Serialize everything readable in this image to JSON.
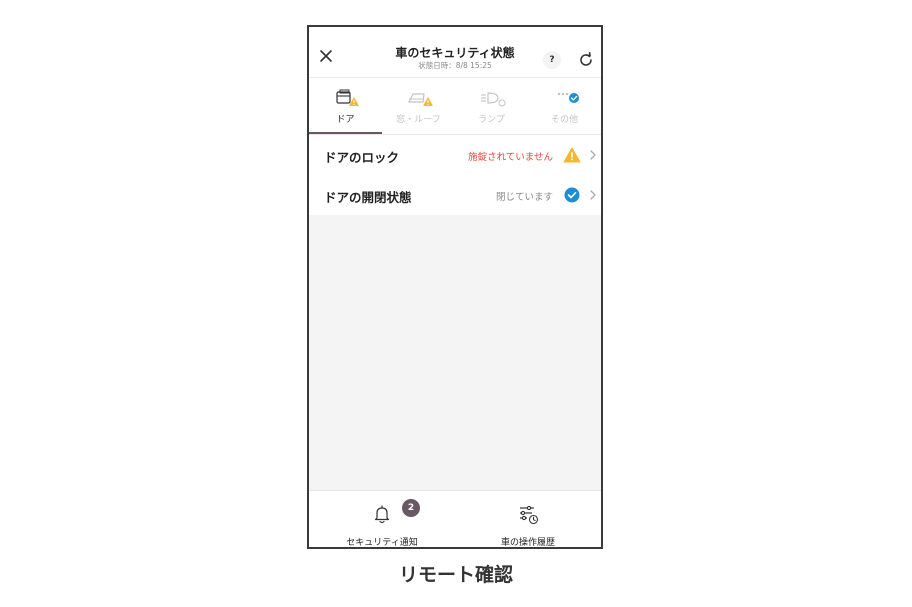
{
  "header": {
    "title": "車のセキュリティ状態",
    "subtitle": "状態日時：8/8 15:25",
    "help_label": "?"
  },
  "tabs": [
    {
      "label": "ドア",
      "icon": "door-icon",
      "status": "warning",
      "active": true
    },
    {
      "label": "窓・ルーフ",
      "icon": "window-roof-icon",
      "status": "warning",
      "active": false
    },
    {
      "label": "ランプ",
      "icon": "lamp-icon",
      "status": "none",
      "active": false
    },
    {
      "label": "その他",
      "icon": "more-icon",
      "status": "ok",
      "active": false
    }
  ],
  "rows": [
    {
      "title": "ドアのロック",
      "status": "施錠されていません",
      "status_type": "warning"
    },
    {
      "title": "ドアの開閉状態",
      "status": "閉じています",
      "status_type": "ok"
    }
  ],
  "bottom_nav": [
    {
      "label": "セキュリティ通知",
      "icon": "bell-icon",
      "badge": "2"
    },
    {
      "label": "車の操作履歴",
      "icon": "history-icon"
    }
  ],
  "caption": "リモート確認",
  "colors": {
    "warning_text": "#e2463a",
    "warning_icon": "#f5b730",
    "ok_icon": "#1a8fd6",
    "accent": "#6a5766",
    "inactive_text": "#c4c4c4"
  }
}
